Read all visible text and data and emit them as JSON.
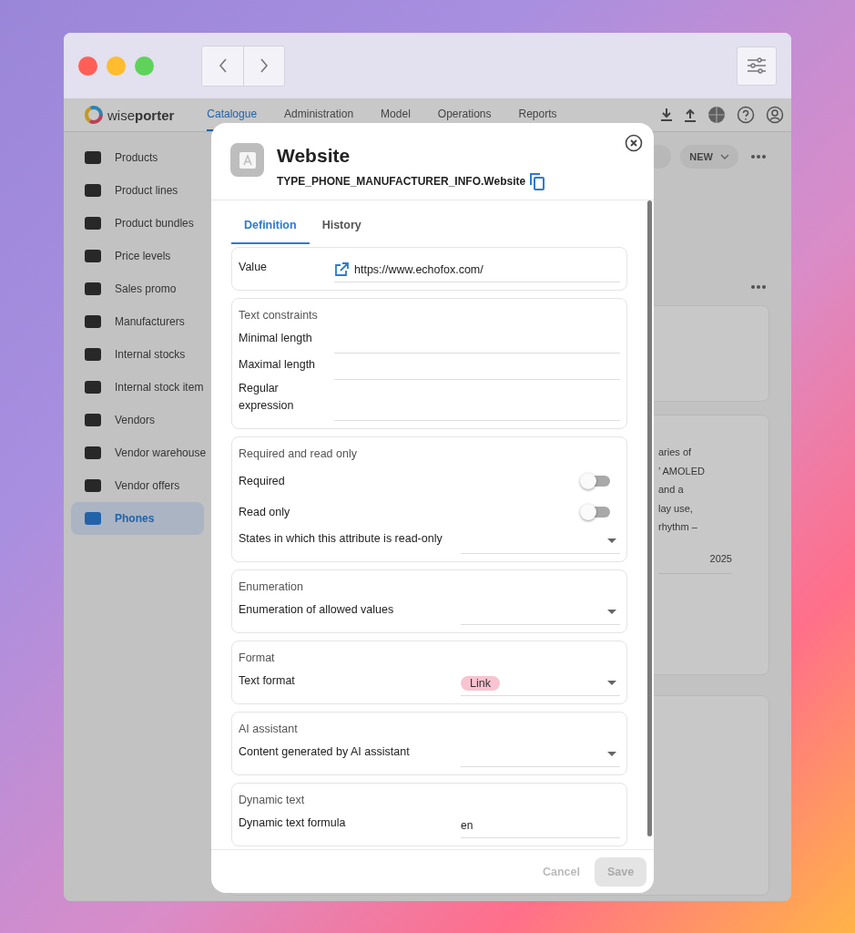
{
  "app": {
    "logo": "wise**porter**",
    "nav_tabs": [
      {
        "label": "Catalogue",
        "selected": true
      },
      {
        "label": "Administration",
        "selected": false
      },
      {
        "label": "Model",
        "selected": false
      },
      {
        "label": "Operations",
        "selected": false
      },
      {
        "label": "Reports",
        "selected": false
      }
    ],
    "sidebar": {
      "items": [
        {
          "label": "Products",
          "selected": false
        },
        {
          "label": "Product lines",
          "selected": false
        },
        {
          "label": "Product bundles",
          "selected": false
        },
        {
          "label": "Price levels",
          "selected": false
        },
        {
          "label": "Sales promo",
          "selected": false
        },
        {
          "label": "Manufacturers",
          "selected": false
        },
        {
          "label": "Internal stocks",
          "selected": false
        },
        {
          "label": "Internal stock item",
          "selected": false
        },
        {
          "label": "Vendors",
          "selected": false
        },
        {
          "label": "Vendor warehouse",
          "selected": false
        },
        {
          "label": "Vendor offers",
          "selected": false
        },
        {
          "label": "Phones",
          "selected": true
        }
      ]
    },
    "toolbar": {
      "new_button": "NEW"
    },
    "description_lines": [
      "aries of",
      "’ AMOLED",
      "and a",
      "lay use,",
      "rhythm –"
    ],
    "year_value": "2025"
  },
  "modal": {
    "title": "Website",
    "api_name": "TYPE_PHONE_MANUFACTURER_INFO.Website",
    "tabs": [
      {
        "label": "Definition",
        "selected": true
      },
      {
        "label": "History",
        "selected": false
      }
    ],
    "sections": [
      {
        "rows": [
          {
            "kind": "link",
            "label": "Value",
            "value": "https://www.echofox.com/"
          }
        ]
      },
      {
        "title": "Text constraints",
        "rows": [
          {
            "kind": "text",
            "label": "Minimal length"
          },
          {
            "kind": "text",
            "label": "Maximal length"
          },
          {
            "kind": "text",
            "label": "Regular expression"
          }
        ]
      },
      {
        "title": "Required and read only",
        "rows": [
          {
            "kind": "toggle",
            "label": "Required",
            "on": false
          },
          {
            "kind": "toggle",
            "label": "Read only",
            "on": false
          },
          {
            "kind": "select",
            "label": "States in which this attribute is read-only"
          }
        ]
      },
      {
        "title": "Enumeration",
        "rows": [
          {
            "kind": "select",
            "label": "Enumeration of allowed values"
          }
        ]
      },
      {
        "title": "Format",
        "rows": [
          {
            "kind": "select",
            "label": "Text format",
            "tag": "Link"
          }
        ]
      },
      {
        "title": "AI assistant",
        "rows": [
          {
            "kind": "select",
            "label": "Content generated by AI assistant"
          }
        ]
      },
      {
        "title": "Dynamic text",
        "rows": [
          {
            "kind": "formula",
            "label": "Dynamic text formula",
            "value": "en"
          }
        ]
      }
    ],
    "footer": {
      "cancel": {
        "label": "Cancel",
        "disabled": true
      },
      "save": {
        "label": "Save",
        "disabled": true
      }
    }
  }
}
